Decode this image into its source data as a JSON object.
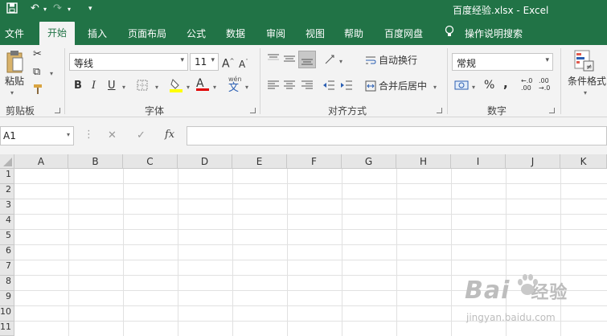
{
  "title_bar": {
    "title": "百度经验.xlsx  -  Excel",
    "save_icon": "save-icon",
    "undo_icon": "undo-icon",
    "redo_icon": "redo-icon",
    "customize_icon": "customize-quick-access-icon"
  },
  "tabs": [
    "文件",
    "开始",
    "插入",
    "页面布局",
    "公式",
    "数据",
    "审阅",
    "视图",
    "帮助",
    "百度网盘"
  ],
  "active_tab": "开始",
  "tell_me": "操作说明搜索",
  "ribbon": {
    "clipboard": {
      "label": "剪贴板",
      "paste": "粘贴"
    },
    "font": {
      "label": "字体",
      "name": "等线",
      "size": "11",
      "increase": "A",
      "decrease": "A",
      "bold": "B",
      "italic": "I",
      "underline": "U",
      "font_color_glyph": "A",
      "phonetic_top": "wén",
      "phonetic_bottom": "文"
    },
    "alignment": {
      "label": "对齐方式",
      "wrap_text": "自动换行",
      "merge_center": "合并后居中"
    },
    "number": {
      "label": "数字",
      "format": "常规",
      "percent": "%",
      "comma": ",",
      "inc_decimal_top": "←.0",
      "inc_decimal_bottom": ".00",
      "dec_decimal_top": ".00",
      "dec_decimal_bottom": "→.0"
    },
    "styles": {
      "conditional_format": "条件格式"
    }
  },
  "formula_bar": {
    "name_box": "A1",
    "fx": "fx",
    "cancel": "✕",
    "enter": "✓",
    "value": ""
  },
  "columns": [
    "A",
    "B",
    "C",
    "D",
    "E",
    "F",
    "G",
    "H",
    "I",
    "J",
    "K"
  ],
  "rows": [
    "1",
    "2",
    "3",
    "4",
    "5",
    "6",
    "7",
    "8",
    "9",
    "10",
    "11"
  ],
  "watermark": {
    "main": "Bai",
    "tail": "经验",
    "sub": "jingyan.baidu.com"
  },
  "colors": {
    "brand": "#217346",
    "fill_highlight": "#ffff00",
    "font_red": "#e00000"
  }
}
